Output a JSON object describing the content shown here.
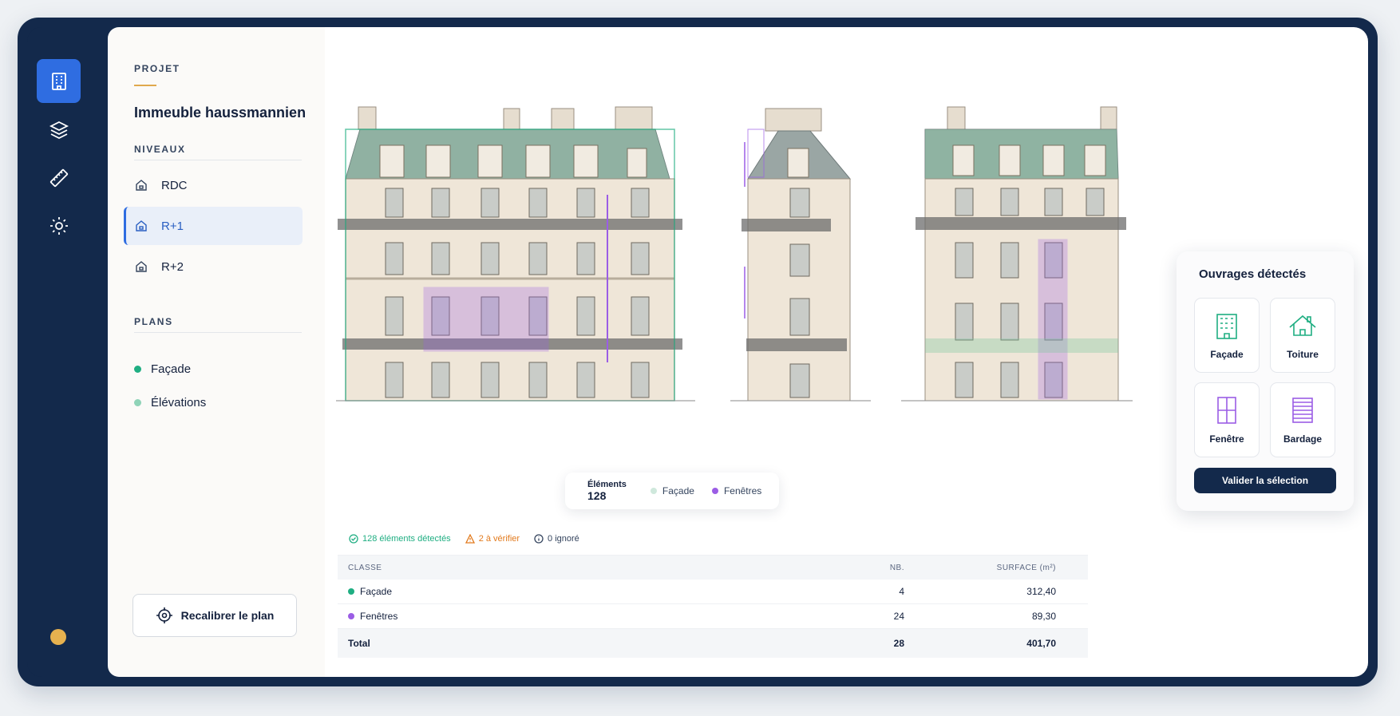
{
  "sidebar": {
    "project_label": "PROJET",
    "project_title": "Immeuble haussmannien",
    "levels_label": "NIVEAUX",
    "levels": [
      {
        "label": "RDC",
        "active": false
      },
      {
        "label": "R+1",
        "active": true
      },
      {
        "label": "R+2",
        "active": false
      }
    ],
    "plans_label": "PLANS",
    "plans": [
      {
        "label": "Façade",
        "color": "#1fae82"
      },
      {
        "label": "Élévations",
        "color": "#8fd3b8"
      }
    ],
    "recalibrate_label": "Recalibrer le plan"
  },
  "rail": {
    "items": [
      "building-icon",
      "layers-icon",
      "ruler-icon",
      "gear-icon"
    ],
    "accent": "#2f6de1"
  },
  "legend": {
    "elements_label": "Éléments",
    "elements_count": "128",
    "items": [
      {
        "label": "Façade",
        "color": "#cfe8dc"
      },
      {
        "label": "Fenêtres",
        "color": "#9b5de5"
      }
    ]
  },
  "table": {
    "status": {
      "detected": "128 éléments détectés",
      "to_verify": "2 à vérifier",
      "ignored": "0 ignoré"
    },
    "headers": {
      "class": "CLASSE",
      "count": "NB.",
      "surface": "SURFACE (m²)"
    },
    "rows": [
      {
        "class": "Façade",
        "count": "4",
        "surface": "312,40",
        "color": "#1fae82"
      },
      {
        "class": "Fenêtres",
        "count": "24",
        "surface": "89,30",
        "color": "#9b5de5"
      }
    ],
    "total": {
      "label": "Total",
      "count": "28",
      "surface": "401,70"
    }
  },
  "card": {
    "title": "Ouvrages détectés",
    "tiles": [
      {
        "label": "Façade",
        "icon": "facade-icon",
        "color": "#1fae82"
      },
      {
        "label": "Toiture",
        "icon": "roof-icon",
        "color": "#1fae82"
      },
      {
        "label": "Fenêtre",
        "icon": "window-icon",
        "color": "#9b5de5"
      },
      {
        "label": "Bardage",
        "icon": "cladding-icon",
        "color": "#9b5de5"
      }
    ],
    "validate_label": "Valider la sélection"
  }
}
